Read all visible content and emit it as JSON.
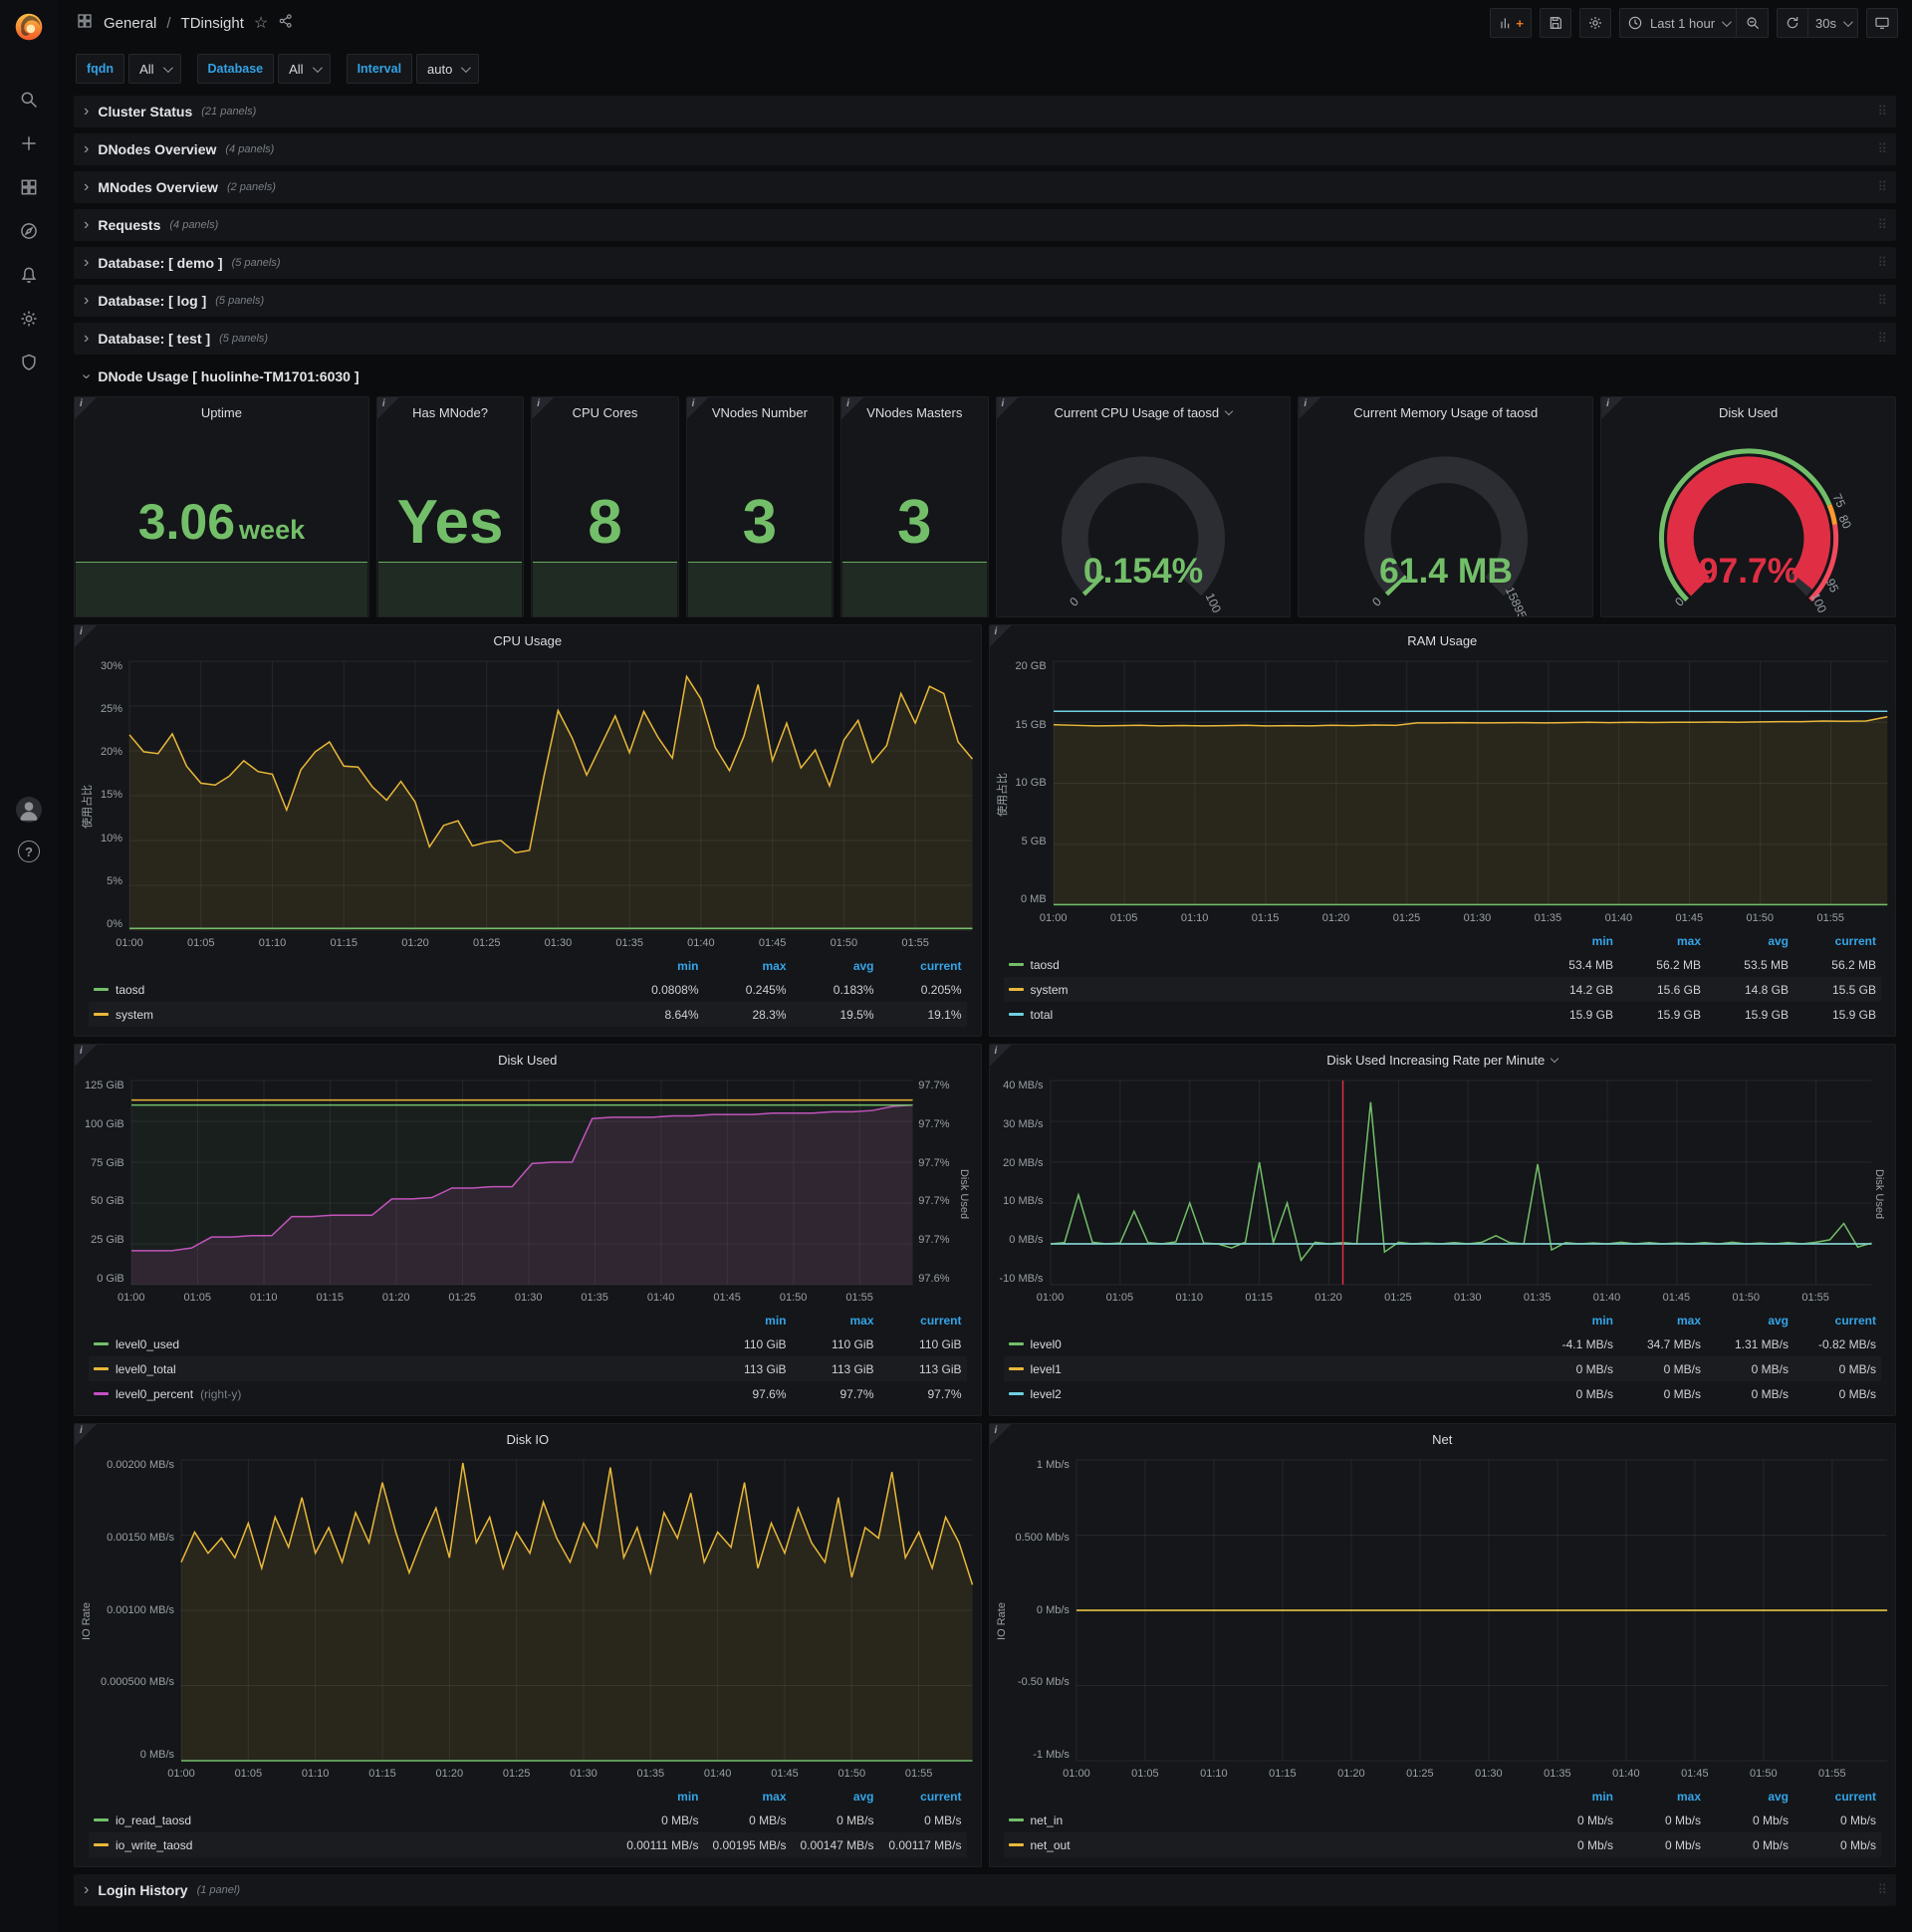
{
  "header": {
    "breadcrumb_section": "General",
    "breadcrumb_sep": "/",
    "title": "TDinsight",
    "time_range": "Last 1 hour",
    "refresh_interval": "30s"
  },
  "variables": [
    {
      "label": "fqdn",
      "value": "All"
    },
    {
      "label": "Database",
      "value": "All"
    },
    {
      "label": "Interval",
      "value": "auto"
    }
  ],
  "rows": [
    {
      "title": "Cluster Status",
      "count": "(21 panels)"
    },
    {
      "title": "DNodes Overview",
      "count": "(4 panels)"
    },
    {
      "title": "MNodes Overview",
      "count": "(2 panels)"
    },
    {
      "title": "Requests",
      "count": "(4 panels)"
    },
    {
      "title": "Database: [ demo ]",
      "count": "(5 panels)"
    },
    {
      "title": "Database: [ log ]",
      "count": "(5 panels)"
    },
    {
      "title": "Database: [ test ]",
      "count": "(5 panels)"
    }
  ],
  "dnode_row": {
    "title": "DNode Usage [ huolinhe-TM1701:6030 ]"
  },
  "login_row": {
    "title": "Login History",
    "count": "(1 panel)"
  },
  "stats": {
    "uptime": {
      "title": "Uptime",
      "value": "3.06",
      "unit": "week"
    },
    "has_mnode": {
      "title": "Has MNode?",
      "value": "Yes"
    },
    "cpu_cores": {
      "title": "CPU Cores",
      "value": "8"
    },
    "vnodes_number": {
      "title": "VNodes Number",
      "value": "3"
    },
    "vnodes_masters": {
      "title": "VNodes Masters",
      "value": "3"
    }
  },
  "gauges": {
    "cpu": {
      "title": "Current CPU Usage of taosd",
      "value": "0.154%",
      "fraction": 0.00154,
      "color": "#73bf69",
      "tick_labels": [
        {
          "f": 0,
          "t": "0"
        },
        {
          "f": 1,
          "t": "100"
        }
      ]
    },
    "memory": {
      "title": "Current Memory Usage of taosd",
      "value": "61.4 MB",
      "fraction": 0.0039,
      "color": "#73bf69",
      "tick_labels": [
        {
          "f": 0,
          "t": "0"
        },
        {
          "f": 1,
          "t": "15895"
        }
      ]
    },
    "disk": {
      "title": "Disk Used",
      "value": "97.7%",
      "fraction": 0.977,
      "color": "#e02f44",
      "thresholds": [
        {
          "from": 0,
          "to": 0.75,
          "color": "#73bf69"
        },
        {
          "from": 0.75,
          "to": 0.8,
          "color": "#ff9830"
        },
        {
          "from": 0.8,
          "to": 1,
          "color": "#f2495c"
        }
      ],
      "tick_labels": [
        {
          "f": 0,
          "t": "0"
        },
        {
          "f": 0.75,
          "t": "75"
        },
        {
          "f": 0.8,
          "t": "80"
        },
        {
          "f": 0.95,
          "t": "95"
        },
        {
          "f": 1,
          "t": "100"
        }
      ]
    }
  },
  "chart_data": {
    "cpu_usage": {
      "type": "line",
      "title": "CPU Usage",
      "ylabel": "使用占比",
      "ymin": 0,
      "ymax": 30,
      "y_ticks": [
        "30%",
        "25%",
        "20%",
        "15%",
        "10%",
        "5%",
        "0%"
      ],
      "x_ticks": [
        "01:00",
        "01:05",
        "01:10",
        "01:15",
        "01:20",
        "01:25",
        "01:30",
        "01:35",
        "01:40",
        "01:45",
        "01:50",
        "01:55"
      ],
      "series": [
        {
          "name": "system",
          "color": "#eab839",
          "fill": "rgba(234,184,57,0.10)",
          "values": [
            21.8,
            19.9,
            19.7,
            21.9,
            18.3,
            16.4,
            16.2,
            17.2,
            18.9,
            17.7,
            17.4,
            13.4,
            17.9,
            19.9,
            21.0,
            18.3,
            18.2,
            16.0,
            14.5,
            16.6,
            14.3,
            9.3,
            11.7,
            12.2,
            9.4,
            9.8,
            10.0,
            8.64,
            8.9,
            17.1,
            24.5,
            21.4,
            17.3,
            20.6,
            23.9,
            19.8,
            24.4,
            21.5,
            19.2,
            28.3,
            25.8,
            20.4,
            17.8,
            21.6,
            27.4,
            18.9,
            23.1,
            18.1,
            20.1,
            16.1,
            21.2,
            23.4,
            18.7,
            20.6,
            26.4,
            23.1,
            27.2,
            26.4,
            21.0,
            19.1
          ]
        },
        {
          "name": "taosd",
          "color": "#73bf69",
          "flat": 0.2
        }
      ],
      "legend": {
        "headers": [
          "min",
          "max",
          "avg",
          "current"
        ],
        "rows": [
          {
            "name": "taosd",
            "color": "#73bf69",
            "values": [
              "0.0808%",
              "0.245%",
              "0.183%",
              "0.205%"
            ]
          },
          {
            "name": "system",
            "color": "#eab839",
            "values": [
              "8.64%",
              "28.3%",
              "19.5%",
              "19.1%"
            ]
          }
        ]
      }
    },
    "ram_usage": {
      "type": "line",
      "title": "RAM Usage",
      "ylabel": "使用占比",
      "ymin": 0,
      "ymax": 20,
      "y_ticks": [
        "20 GB",
        "15 GB",
        "10 GB",
        "5 GB",
        "0 MB"
      ],
      "x_ticks": [
        "01:00",
        "01:05",
        "01:10",
        "01:15",
        "01:20",
        "01:25",
        "01:30",
        "01:35",
        "01:40",
        "01:45",
        "01:50",
        "01:55"
      ],
      "series": [
        {
          "name": "system",
          "color": "#eab839",
          "fill": "rgba(234,184,57,0.10)",
          "values": [
            14.8,
            14.75,
            14.7,
            14.72,
            14.75,
            14.7,
            14.73,
            14.7,
            14.72,
            14.75,
            14.7,
            14.72,
            14.7,
            14.75,
            14.72,
            14.78,
            14.75,
            14.95,
            14.95,
            14.97,
            14.95,
            14.96,
            14.97,
            14.95,
            14.97,
            15.0,
            14.97,
            15.0,
            14.98,
            15.0,
            15.0,
            15.02,
            15.0,
            15.03,
            15.05,
            15.05,
            15.1,
            15.08,
            15.1,
            15.45
          ]
        },
        {
          "name": "total",
          "color": "#6ed0e0",
          "flat": 15.9
        },
        {
          "name": "taosd",
          "color": "#73bf69",
          "flat": 0.055
        }
      ],
      "legend": {
        "headers": [
          "min",
          "max",
          "avg",
          "current"
        ],
        "rows": [
          {
            "name": "taosd",
            "color": "#73bf69",
            "values": [
              "53.4 MB",
              "56.2 MB",
              "53.5 MB",
              "56.2 MB"
            ]
          },
          {
            "name": "system",
            "color": "#eab839",
            "values": [
              "14.2 GB",
              "15.6 GB",
              "14.8 GB",
              "15.5 GB"
            ]
          },
          {
            "name": "total",
            "color": "#6ed0e0",
            "values": [
              "15.9 GB",
              "15.9 GB",
              "15.9 GB",
              "15.9 GB"
            ]
          }
        ]
      }
    },
    "disk_used": {
      "type": "line",
      "title": "Disk Used",
      "right_label": "Disk Used",
      "ymin": 0,
      "ymax": 125,
      "right_min": 97.575,
      "right_max": 97.725,
      "y_ticks": [
        "125 GiB",
        "100 GiB",
        "75 GiB",
        "50 GiB",
        "25 GiB",
        "0 GiB"
      ],
      "right_ticks": [
        "97.7%",
        "97.7%",
        "97.7%",
        "97.7%",
        "97.7%",
        "97.6%"
      ],
      "x_ticks": [
        "01:00",
        "01:05",
        "01:10",
        "01:15",
        "01:20",
        "01:25",
        "01:30",
        "01:35",
        "01:40",
        "01:45",
        "01:50",
        "01:55"
      ],
      "series": [
        {
          "name": "level0_percent",
          "color": "#c74ec2",
          "axis": "right",
          "fill": "rgba(199,78,194,0.13)",
          "values": [
            97.6,
            97.6,
            97.6,
            97.602,
            97.61,
            97.61,
            97.611,
            97.611,
            97.625,
            97.625,
            97.626,
            97.626,
            97.626,
            97.638,
            97.638,
            97.639,
            97.646,
            97.646,
            97.647,
            97.647,
            97.664,
            97.665,
            97.665,
            97.697,
            97.698,
            97.698,
            97.698,
            97.699,
            97.699,
            97.7,
            97.7,
            97.7,
            97.701,
            97.701,
            97.701,
            97.702,
            97.702,
            97.703,
            97.706,
            97.707
          ]
        },
        {
          "name": "level0_used",
          "color": "#73bf69",
          "flat": 110,
          "fill": "rgba(115,191,105,0.06)"
        },
        {
          "name": "level0_total",
          "color": "#eab839",
          "flat": 113
        }
      ],
      "legend": {
        "headers": [
          "min",
          "max",
          "current"
        ],
        "rows": [
          {
            "name": "level0_used",
            "color": "#73bf69",
            "values": [
              "110 GiB",
              "110 GiB",
              "110 GiB"
            ]
          },
          {
            "name": "level0_total",
            "color": "#eab839",
            "values": [
              "113 GiB",
              "113 GiB",
              "113 GiB"
            ]
          },
          {
            "name": "level0_percent",
            "suffix": "(right-y)",
            "color": "#c74ec2",
            "values": [
              "97.6%",
              "97.7%",
              "97.7%"
            ]
          }
        ]
      }
    },
    "disk_rate": {
      "type": "line",
      "title": "Disk Used Increasing Rate per Minute",
      "right_label": "Disk Used",
      "ymin": -10,
      "ymax": 40,
      "y_ticks": [
        "40 MB/s",
        "30 MB/s",
        "20 MB/s",
        "10 MB/s",
        "0 MB/s",
        "-10 MB/s"
      ],
      "x_ticks": [
        "01:00",
        "01:05",
        "01:10",
        "01:15",
        "01:20",
        "01:25",
        "01:30",
        "01:35",
        "01:40",
        "01:45",
        "01:50",
        "01:55"
      ],
      "annotation": {
        "f": 0.356,
        "color": "#e02f44"
      },
      "series": [
        {
          "name": "level0",
          "color": "#73bf69",
          "values": [
            0,
            0.3,
            12,
            0.4,
            0,
            0.2,
            8,
            0.3,
            0,
            0.5,
            10,
            0.2,
            0,
            -1,
            0.4,
            20,
            0.3,
            10,
            -4,
            0.4,
            0,
            0.3,
            0,
            34.7,
            -2,
            0.4,
            0,
            0.2,
            0,
            0.3,
            0,
            0.4,
            2,
            0.3,
            0,
            19.5,
            -1.5,
            0.3,
            0,
            0.2,
            0,
            0.4,
            0,
            0.3,
            0,
            0.2,
            0,
            0.3,
            0,
            0.4,
            0,
            0.2,
            0,
            0.3,
            0,
            0.4,
            1,
            5,
            -0.8,
            0.2
          ]
        },
        {
          "name": "level1",
          "color": "#eab839",
          "flat": 0
        },
        {
          "name": "level2",
          "color": "#6ed0e0",
          "flat": 0
        }
      ],
      "legend": {
        "headers": [
          "min",
          "max",
          "avg",
          "current"
        ],
        "rows": [
          {
            "name": "level0",
            "color": "#73bf69",
            "values": [
              "-4.1 MB/s",
              "34.7 MB/s",
              "1.31 MB/s",
              "-0.82 MB/s"
            ]
          },
          {
            "name": "level1",
            "color": "#eab839",
            "values": [
              "0 MB/s",
              "0 MB/s",
              "0 MB/s",
              "0 MB/s"
            ]
          },
          {
            "name": "level2",
            "color": "#6ed0e0",
            "values": [
              "0 MB/s",
              "0 MB/s",
              "0 MB/s",
              "0 MB/s"
            ]
          }
        ]
      }
    },
    "disk_io": {
      "type": "line",
      "title": "Disk IO",
      "ylabel": "IO Rate",
      "ymin": 0,
      "ymax": 0.002,
      "y_ticks": [
        "0.00200 MB/s",
        "0.00150 MB/s",
        "0.00100 MB/s",
        "0.000500 MB/s",
        "0 MB/s"
      ],
      "x_ticks": [
        "01:00",
        "01:05",
        "01:10",
        "01:15",
        "01:20",
        "01:25",
        "01:30",
        "01:35",
        "01:40",
        "01:45",
        "01:50",
        "01:55"
      ],
      "series": [
        {
          "name": "io_write_taosd",
          "color": "#eab839",
          "fill": "rgba(234,184,57,0.10)",
          "values": [
            0.00132,
            0.00152,
            0.00138,
            0.00148,
            0.00135,
            0.00158,
            0.00128,
            0.00162,
            0.00142,
            0.00175,
            0.00138,
            0.00155,
            0.00132,
            0.00165,
            0.00145,
            0.00185,
            0.00152,
            0.00125,
            0.00148,
            0.00168,
            0.00135,
            0.00198,
            0.00145,
            0.00162,
            0.00128,
            0.00152,
            0.00138,
            0.00172,
            0.00148,
            0.00132,
            0.00158,
            0.00142,
            0.00195,
            0.00135,
            0.00155,
            0.00125,
            0.00165,
            0.00148,
            0.00178,
            0.00132,
            0.00152,
            0.00142,
            0.00185,
            0.00128,
            0.00158,
            0.00138,
            0.00168,
            0.00145,
            0.00132,
            0.00175,
            0.00122,
            0.00155,
            0.00148,
            0.00192,
            0.00135,
            0.00152,
            0.00128,
            0.00162,
            0.00145,
            0.00117
          ]
        },
        {
          "name": "io_read_taosd",
          "color": "#73bf69",
          "flat": 0
        }
      ],
      "legend": {
        "headers": [
          "min",
          "max",
          "avg",
          "current"
        ],
        "rows": [
          {
            "name": "io_read_taosd",
            "color": "#73bf69",
            "values": [
              "0 MB/s",
              "0 MB/s",
              "0 MB/s",
              "0 MB/s"
            ]
          },
          {
            "name": "io_write_taosd",
            "color": "#eab839",
            "values": [
              "0.00111 MB/s",
              "0.00195 MB/s",
              "0.00147 MB/s",
              "0.00117 MB/s"
            ]
          }
        ]
      }
    },
    "net": {
      "type": "line",
      "title": "Net",
      "ylabel": "IO Rate",
      "ymin": -1,
      "ymax": 1,
      "y_ticks": [
        "1 Mb/s",
        "0.500 Mb/s",
        "0 Mb/s",
        "-0.50 Mb/s",
        "-1 Mb/s"
      ],
      "x_ticks": [
        "01:00",
        "01:05",
        "01:10",
        "01:15",
        "01:20",
        "01:25",
        "01:30",
        "01:35",
        "01:40",
        "01:45",
        "01:50",
        "01:55"
      ],
      "series": [
        {
          "name": "net_in",
          "color": "#73bf69",
          "flat": 0
        },
        {
          "name": "net_out",
          "color": "#eab839",
          "flat": 0
        }
      ],
      "legend": {
        "headers": [
          "min",
          "max",
          "avg",
          "current"
        ],
        "rows": [
          {
            "name": "net_in",
            "color": "#73bf69",
            "values": [
              "0 Mb/s",
              "0 Mb/s",
              "0 Mb/s",
              "0 Mb/s"
            ]
          },
          {
            "name": "net_out",
            "color": "#eab839",
            "values": [
              "0 Mb/s",
              "0 Mb/s",
              "0 Mb/s",
              "0 Mb/s"
            ]
          }
        ]
      }
    }
  }
}
